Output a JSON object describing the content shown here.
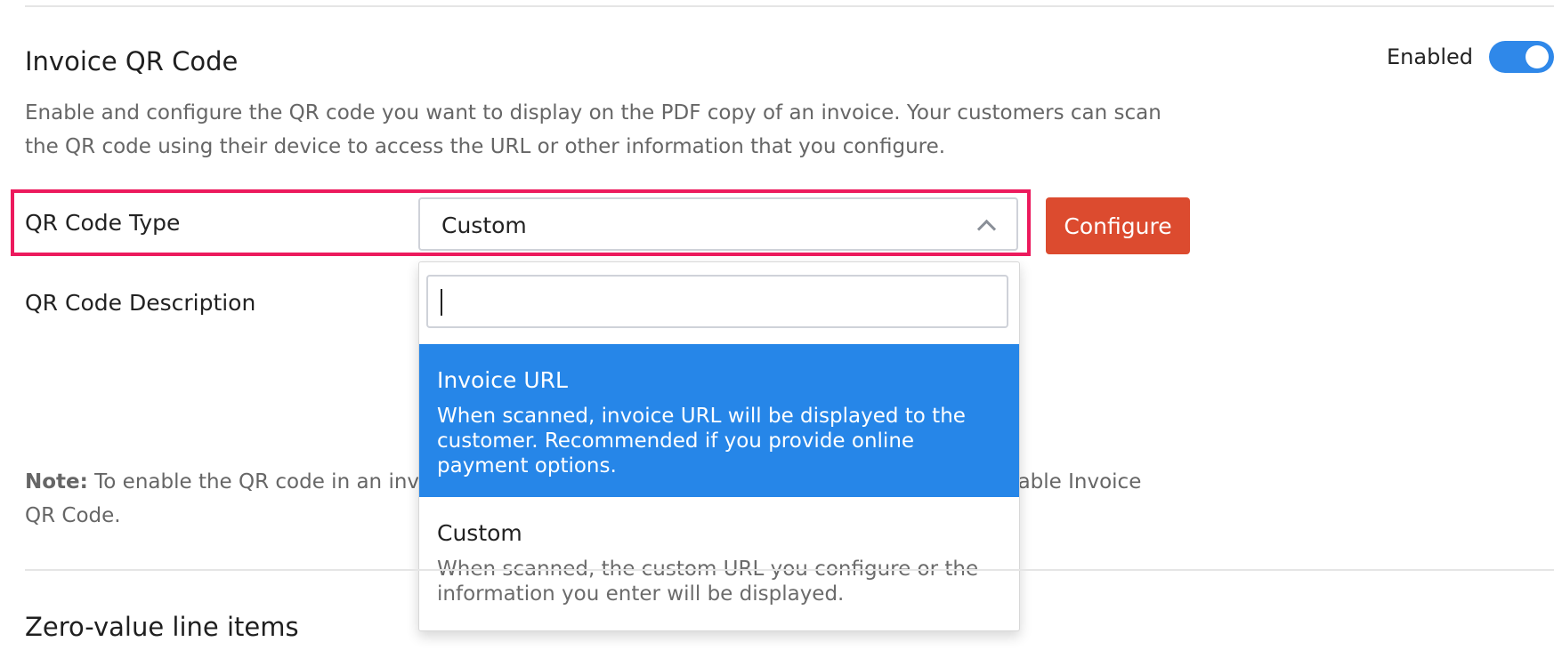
{
  "section": {
    "title": "Invoice QR Code",
    "toggle_label": "Enabled",
    "description": "Enable and configure the QR code you want to display on the PDF copy of an invoice. Your customers can scan the QR code using their device to access the URL or other information that you configure."
  },
  "form": {
    "type_label": "QR Code Type",
    "type_value": "Custom",
    "description_label": "QR Code Description",
    "configure_label": "Configure"
  },
  "dropdown": {
    "search_value": "",
    "options": [
      {
        "title": "Invoice URL",
        "description": "When scanned, invoice URL will be displayed to the customer. Recommended if you provide online payment options."
      },
      {
        "title": "Custom",
        "description": "When scanned, the custom URL you configure or the information you enter will be displayed."
      }
    ]
  },
  "note": {
    "label": "Note:",
    "text_start": "To enable the QR code in an invo",
    "text_end": "nable Invoice",
    "text_line2": "QR Code."
  },
  "next_section": {
    "title": "Zero-value line items"
  },
  "colors": {
    "accent_blue": "#2686e8",
    "configure_button": "#dc4b2f",
    "highlight_border": "#ec1a5d"
  }
}
